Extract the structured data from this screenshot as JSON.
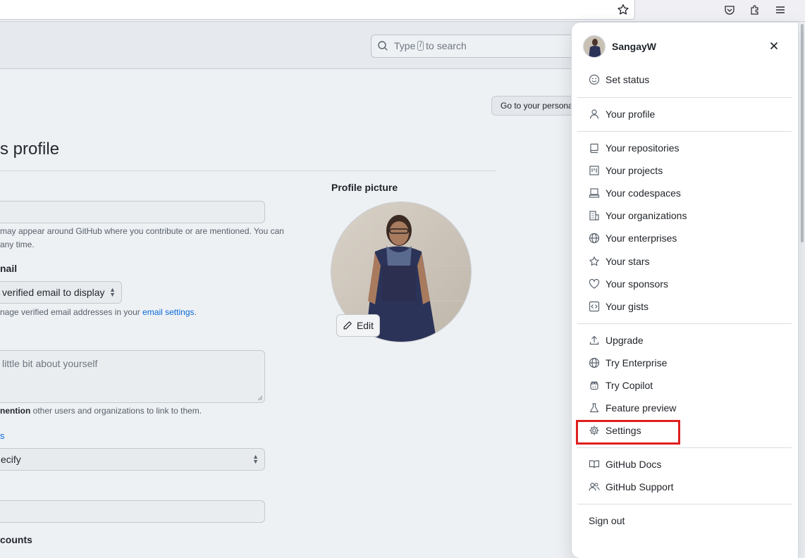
{
  "header": {
    "search_placeholder_pre": "Type",
    "search_key": "/",
    "search_placeholder_post": "to search"
  },
  "page": {
    "persona_button": "Go to your personal profile",
    "title": "s profile",
    "name_note_line1": "may appear around GitHub where you contribute or are mentioned. You can",
    "name_note_line2": " any time.",
    "email_label": "nail",
    "email_select_value": "verified email to display",
    "email_note_pre": "nage verified email addresses in your",
    "email_note_link": "email settings",
    "email_note_post": ".",
    "bio_placeholder": " little bit about yourself",
    "bio_note_bold": "nention",
    "bio_note_rest": " other users and organizations to link to them.",
    "pronouns_label": "s",
    "pronouns_value": "ecify",
    "accounts_label": "counts",
    "profile_picture_label": "Profile picture",
    "edit_button": "Edit"
  },
  "menu": {
    "username": "SangayW",
    "items": [
      {
        "label": "Set status",
        "icon": "smiley-icon"
      },
      {
        "label": "Your profile",
        "icon": "person-icon"
      },
      {
        "label": "Your repositories",
        "icon": "repo-icon"
      },
      {
        "label": "Your projects",
        "icon": "project-icon"
      },
      {
        "label": "Your codespaces",
        "icon": "codespaces-icon"
      },
      {
        "label": "Your organizations",
        "icon": "organization-icon"
      },
      {
        "label": "Your enterprises",
        "icon": "globe-icon"
      },
      {
        "label": "Your stars",
        "icon": "star-icon"
      },
      {
        "label": "Your sponsors",
        "icon": "heart-icon"
      },
      {
        "label": "Your gists",
        "icon": "code-square-icon"
      },
      {
        "label": "Upgrade",
        "icon": "upload-icon"
      },
      {
        "label": "Try Enterprise",
        "icon": "globe-icon"
      },
      {
        "label": "Try Copilot",
        "icon": "copilot-icon"
      },
      {
        "label": "Feature preview",
        "icon": "beaker-icon"
      },
      {
        "label": "Settings",
        "icon": "gear-icon"
      },
      {
        "label": "GitHub Docs",
        "icon": "book-icon"
      },
      {
        "label": "GitHub Support",
        "icon": "people-icon"
      },
      {
        "label": "Sign out",
        "icon": ""
      }
    ]
  },
  "colors": {
    "highlight": "#e01e1e",
    "link": "#0969da"
  }
}
